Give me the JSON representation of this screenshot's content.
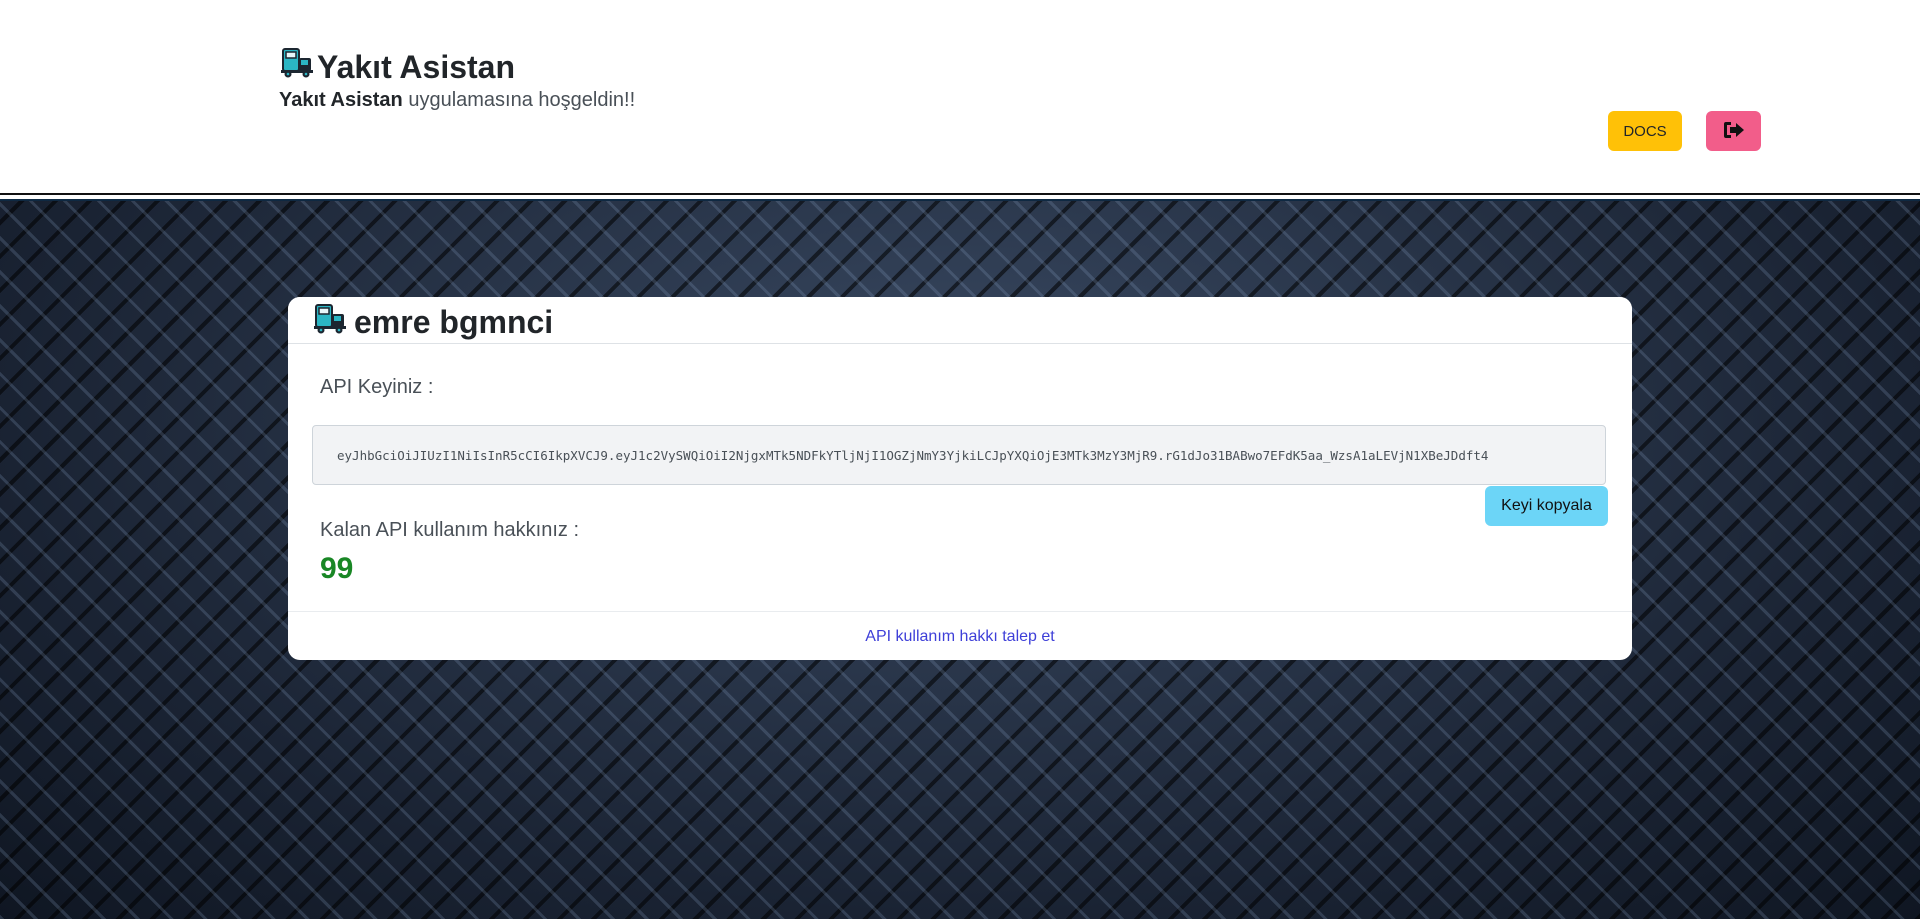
{
  "header": {
    "app_title": "Yakıt Asistan",
    "welcome_bold": "Yakıt Asistan",
    "welcome_rest": " uygulamasına hoşgeldin!!",
    "docs_label": "DOCS",
    "logout_icon": "sign-out-icon",
    "colors": {
      "docs": "#ffc107",
      "logout": "#f25d8a"
    }
  },
  "card": {
    "user_name": "emre bgmnci",
    "api_key_label": "API Keyiniz :",
    "api_key": "eyJhbGciOiJIUzI1NiIsInR5cCI6IkpXVCJ9.eyJ1c2VySWQiOiI2NjgxMTk5NDFkYTljNjI1OGZjNmY3YjkiLCJpYXQiOjE3MTk3MzY3MjR9.rG1dJo31BABwo7EFdK5aa_WzsA1aLEVjN1XBeJDdft4",
    "copy_label": "Keyi kopyala",
    "remaining_label": "Kalan API kullanım hakkınız :",
    "remaining_value": "99",
    "request_link": "API kullanım hakkı talep et",
    "icon": "fuel-truck-icon",
    "colors": {
      "copy": "#6cd5f7",
      "remaining": "#198725",
      "link": "#3e3fd8"
    }
  }
}
